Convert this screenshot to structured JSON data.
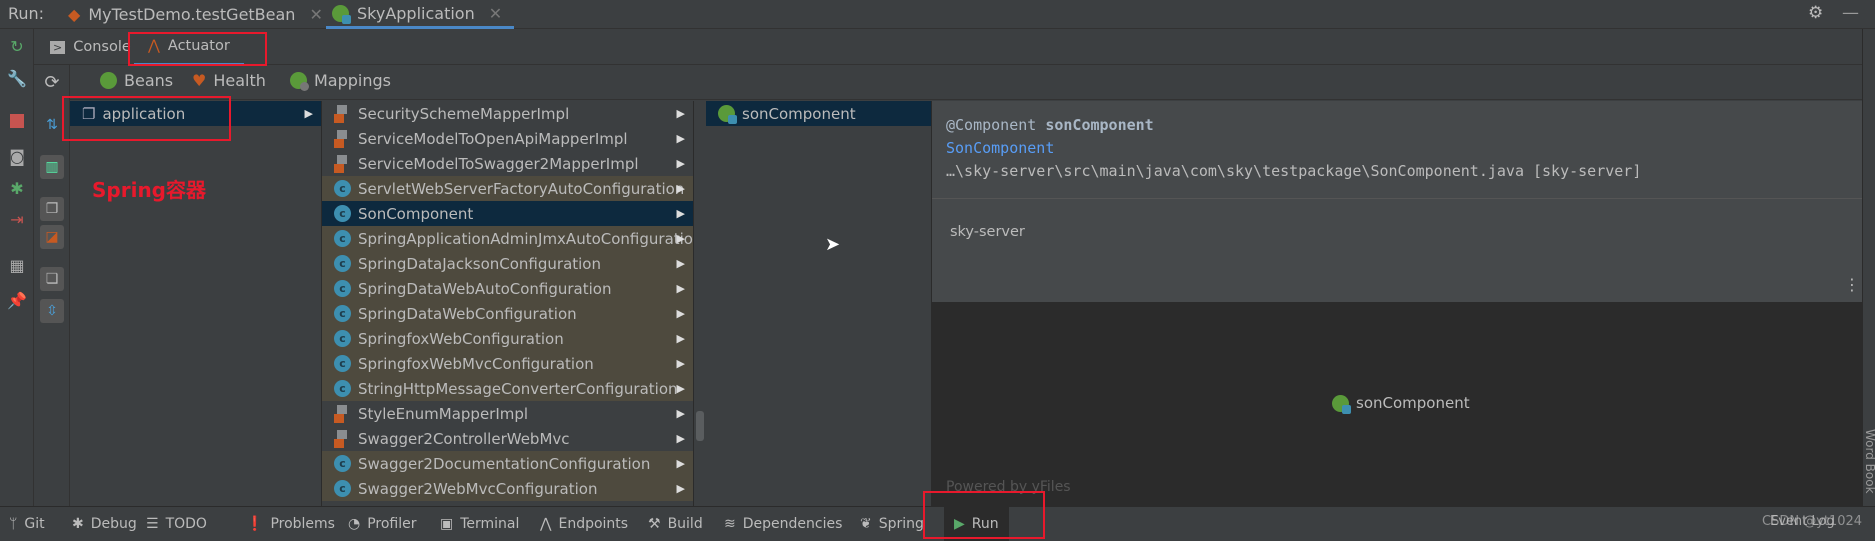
{
  "run_bar": {
    "label": "Run:",
    "tabs": [
      {
        "label": "MyTestDemo.testGetBean",
        "icon": "junit-icon"
      },
      {
        "label": "SkyApplication",
        "icon": "spring-boot-icon",
        "active": true
      }
    ]
  },
  "sub_tabs": [
    {
      "label": "Console",
      "icon": "console-icon"
    },
    {
      "label": "Actuator",
      "icon": "actuator-icon",
      "active": true
    }
  ],
  "actuator_tabs": [
    {
      "label": "Beans",
      "icon": "beans-icon",
      "active": true
    },
    {
      "label": "Health",
      "icon": "health-icon"
    },
    {
      "label": "Mappings",
      "icon": "mappings-icon"
    }
  ],
  "contexts": [
    {
      "label": "application",
      "selected": true
    }
  ],
  "beans": [
    {
      "label": "SecuritySchemeMapperImpl",
      "kind": "bean"
    },
    {
      "label": "ServiceModelToOpenApiMapperImpl",
      "kind": "bean"
    },
    {
      "label": "ServiceModelToSwagger2MapperImpl",
      "kind": "bean"
    },
    {
      "label": "ServletWebServerFactoryAutoConfiguration",
      "kind": "config"
    },
    {
      "label": "SonComponent",
      "kind": "class",
      "selected": true
    },
    {
      "label": "SpringApplicationAdminJmxAutoConfiguration",
      "kind": "config"
    },
    {
      "label": "SpringDataJacksonConfiguration",
      "kind": "config"
    },
    {
      "label": "SpringDataWebAutoConfiguration",
      "kind": "config"
    },
    {
      "label": "SpringDataWebConfiguration",
      "kind": "config"
    },
    {
      "label": "SpringfoxWebConfiguration",
      "kind": "config"
    },
    {
      "label": "SpringfoxWebMvcConfiguration",
      "kind": "config"
    },
    {
      "label": "StringHttpMessageConverterConfiguration",
      "kind": "config"
    },
    {
      "label": "StyleEnumMapperImpl",
      "kind": "bean"
    },
    {
      "label": "Swagger2ControllerWebMvc",
      "kind": "bean"
    },
    {
      "label": "Swagger2DocumentationConfiguration",
      "kind": "config"
    },
    {
      "label": "Swagger2WebMvcConfiguration",
      "kind": "config"
    }
  ],
  "dependencies": [
    {
      "label": "sonComponent"
    }
  ],
  "detail": {
    "annotation": "@Component",
    "bean_name": "sonComponent",
    "class_name": "SonComponent",
    "path": "…\\sky-server\\src\\main\\java\\com\\sky\\testpackage\\SonComponent.java [sky-server]",
    "module": "sky-server",
    "graph_node": "sonComponent",
    "graph_footer": "Powered by yFiles"
  },
  "annotation_text": "Spring容器",
  "status_bar": [
    {
      "label": "Git",
      "icon": "git-icon"
    },
    {
      "label": "Debug",
      "icon": "bug-icon"
    },
    {
      "label": "TODO",
      "icon": "list-icon"
    },
    {
      "label": "Problems",
      "icon": "warning-icon"
    },
    {
      "label": "Profiler",
      "icon": "profiler-icon"
    },
    {
      "label": "Terminal",
      "icon": "terminal-icon"
    },
    {
      "label": "Endpoints",
      "icon": "endpoints-icon"
    },
    {
      "label": "Build",
      "icon": "hammer-icon"
    },
    {
      "label": "Dependencies",
      "icon": "layers-icon"
    },
    {
      "label": "Spring",
      "icon": "spring-leaf-icon"
    },
    {
      "label": "Run",
      "icon": "play-icon",
      "active": true
    }
  ],
  "event_log": "Event Log",
  "watermark": "CSDN @yt1024",
  "right_strip": "Word Book",
  "colors": {
    "accent": "#4a88c7",
    "selected": "#0d293e",
    "config_row": "#4e4a3e",
    "annotation_red": "#e8192c"
  }
}
